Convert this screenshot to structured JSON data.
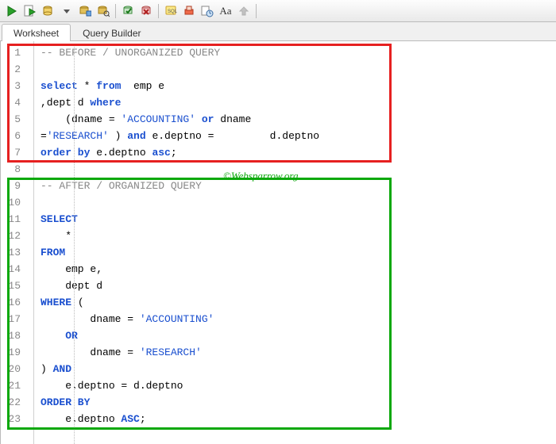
{
  "tabs": {
    "worksheet": "Worksheet",
    "querybuilder": "Query Builder"
  },
  "watermark": "©Websparrow.org",
  "code": {
    "l1": "-- BEFORE / UNORGANIZED QUERY",
    "l2": "",
    "l3a": "select",
    "l3b": " * ",
    "l3c": "from",
    "l3d": "  emp e",
    "l4a": ",dept d ",
    "l4b": "where",
    "l5a": "    (dname = ",
    "l5b": "'ACCOUNTING'",
    "l5c": " ",
    "l5d": "or",
    "l5e": " dname",
    "l6a": "=",
    "l6b": "'RESEARCH'",
    "l6c": " ) ",
    "l6d": "and",
    "l6e": " e.deptno =         d.deptno",
    "l7a": "order by",
    "l7b": " e.deptno ",
    "l7c": "asc",
    "l7d": ";",
    "l8": "",
    "l9": "-- AFTER / ORGANIZED QUERY",
    "l10": "",
    "l11": "SELECT",
    "l12": "    *",
    "l13": "FROM",
    "l14": "    emp e,",
    "l15": "    dept d",
    "l16a": "WHERE",
    "l16b": " (",
    "l17a": "        dname = ",
    "l17b": "'ACCOUNTING'",
    "l18": "    OR",
    "l19a": "        dname = ",
    "l19b": "'RESEARCH'",
    "l20a": ") ",
    "l20b": "AND",
    "l21": "    e.deptno = d.deptno",
    "l22": "ORDER BY",
    "l23a": "    e.deptno ",
    "l23b": "ASC",
    "l23c": ";"
  },
  "linenums": [
    "1",
    "2",
    "3",
    "4",
    "5",
    "6",
    "7",
    "8",
    "9",
    "10",
    "11",
    "12",
    "13",
    "14",
    "15",
    "16",
    "17",
    "18",
    "19",
    "20",
    "21",
    "22",
    "23"
  ]
}
